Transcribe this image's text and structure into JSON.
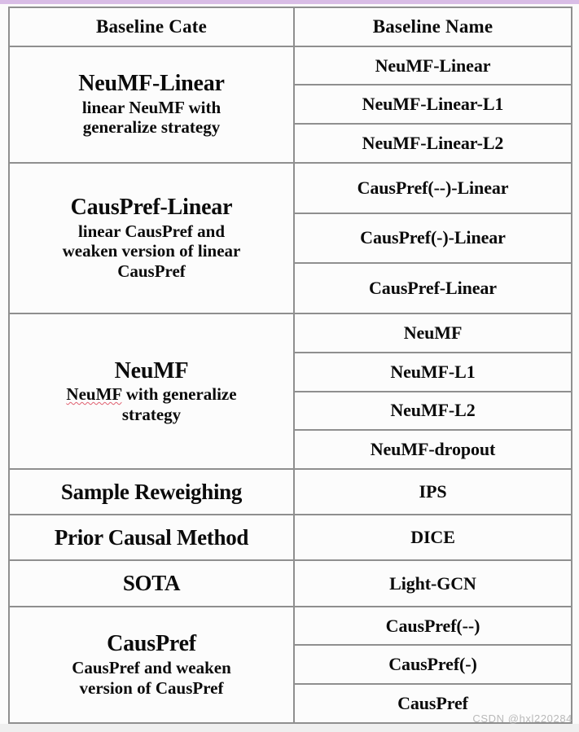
{
  "table": {
    "headers": {
      "left": "Baseline Cate",
      "right": "Baseline Name"
    },
    "groups": [
      {
        "title": "NeuMF-Linear",
        "description_line1": "linear NeuMF with",
        "description_line2": "generalize strategy",
        "description_full": "linear NeuMF with generalize strategy",
        "names": [
          "NeuMF-Linear",
          "NeuMF-Linear-L1",
          "NeuMF-Linear-L2"
        ]
      },
      {
        "title": "CausPref-Linear",
        "description_line1": "linear CausPref and",
        "description_line2": "weaken version of linear",
        "description_line3": "CausPref",
        "description_full": "linear CausPref and weaken version of linear CausPref",
        "names": [
          "CausPref(--)-Linear",
          "CausPref(-)-Linear",
          "CausPref-Linear"
        ]
      },
      {
        "title": "NeuMF",
        "description_misspelled": "NeuMF",
        "description_rest": " with generalize",
        "description_line2": "strategy",
        "description_full": "NeuMF with generalize strategy",
        "names": [
          "NeuMF",
          "NeuMF-L1",
          "NeuMF-L2",
          "NeuMF-dropout"
        ]
      },
      {
        "title": "Sample Reweighing",
        "description_full": "",
        "names": [
          "IPS"
        ]
      },
      {
        "title": "Prior Causal Method",
        "description_full": "",
        "names": [
          "DICE"
        ]
      },
      {
        "title": "SOTA",
        "description_full": "",
        "names": [
          "Light-GCN"
        ]
      },
      {
        "title": "CausPref",
        "description_line1": "CausPref and weaken",
        "description_line2": "version of CausPref",
        "description_full": "CausPref and weaken version of CausPref",
        "names": [
          "CausPref(--)",
          "CausPref(-)",
          "CausPref"
        ]
      }
    ]
  },
  "watermark": "CSDN @hxl220284",
  "colors": {
    "top_band": "#d9bde6",
    "border": "#8f8f8f",
    "text": "#0b0b0b",
    "page_background": "#fbfbfb",
    "cell_background": "#fcfcfc",
    "watermark": "#b9b9b9",
    "spellcheck_underline": "#e06070"
  }
}
